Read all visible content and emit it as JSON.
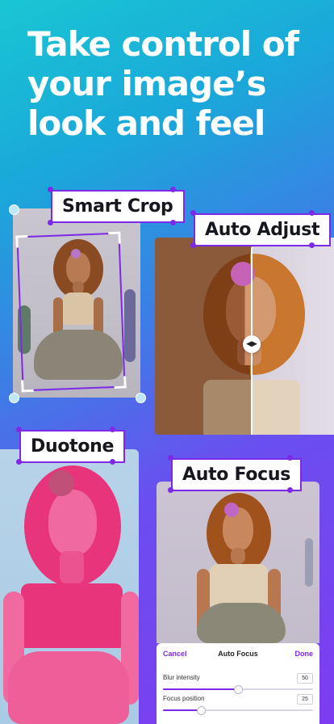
{
  "headline": {
    "line1": "Take control of",
    "line2": "your image’s",
    "line3": "look and feel"
  },
  "features": {
    "smart_crop": "Smart Crop",
    "auto_adjust": "Auto Adjust",
    "duotone": "Duotone",
    "auto_focus": "Auto Focus"
  },
  "editor_panel": {
    "cancel_label": "Cancel",
    "title": "Auto Focus",
    "done_label": "Done",
    "sliders": [
      {
        "label": "Blur intensity",
        "value": "50",
        "level": 0.5
      },
      {
        "label": "Focus position",
        "value": "25",
        "level": 0.25
      }
    ]
  },
  "colors": {
    "accent": "#7d2ae8",
    "duotone_pink": "#e8347a",
    "duotone_blue": "#a9cfe8",
    "auto_adjust_warm": "#c6823c",
    "auto_adjust_cool": "#d7d1df"
  },
  "icons": {
    "divider_knob": "left-right-arrows-icon"
  }
}
